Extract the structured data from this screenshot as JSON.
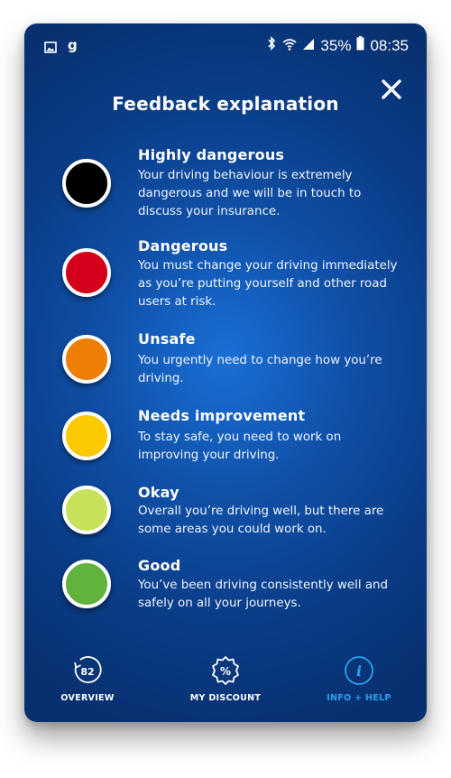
{
  "status_bar": {
    "battery_percent": "35%",
    "time": "08:35",
    "icons": [
      "gallery-icon",
      "g-app-icon",
      "bluetooth-icon",
      "wifi-icon",
      "signal-icon",
      "battery-icon"
    ]
  },
  "header": {
    "title": "Feedback explanation",
    "close_icon": "close-icon"
  },
  "feedback_levels": [
    {
      "heading": "Highly dangerous",
      "description": "Your driving behaviour is extremely dangerous and we will be in touch to discuss your insurance.",
      "color": "#000000"
    },
    {
      "heading": "Dangerous",
      "description": "You must change your driving immediately as you’re putting yourself and other road users at risk.",
      "color": "#d4001a"
    },
    {
      "heading": "Unsafe",
      "description": "You urgently need to change how you’re driving.",
      "color": "#ee7e05"
    },
    {
      "heading": "Needs improvement",
      "description": "To stay safe, you need to work on improving your driving.",
      "color": "#fbc902"
    },
    {
      "heading": "Okay",
      "description": "Overall you’re driving well, but there are some areas you could work on.",
      "color": "#c7e25a"
    },
    {
      "heading": "Good",
      "description": "You’ve been driving consistently well and safely on all your journeys.",
      "color": "#62b33d"
    }
  ],
  "bottom_nav": {
    "overview": {
      "label": "OVERVIEW",
      "score": "82",
      "icon": "score-ring-icon"
    },
    "discount": {
      "label": "MY DISCOUNT",
      "icon": "percent-badge-icon",
      "symbol": "%"
    },
    "help": {
      "label": "INFO + HELP",
      "icon": "info-icon",
      "symbol": "i",
      "active_color": "#2fa0f2"
    }
  }
}
